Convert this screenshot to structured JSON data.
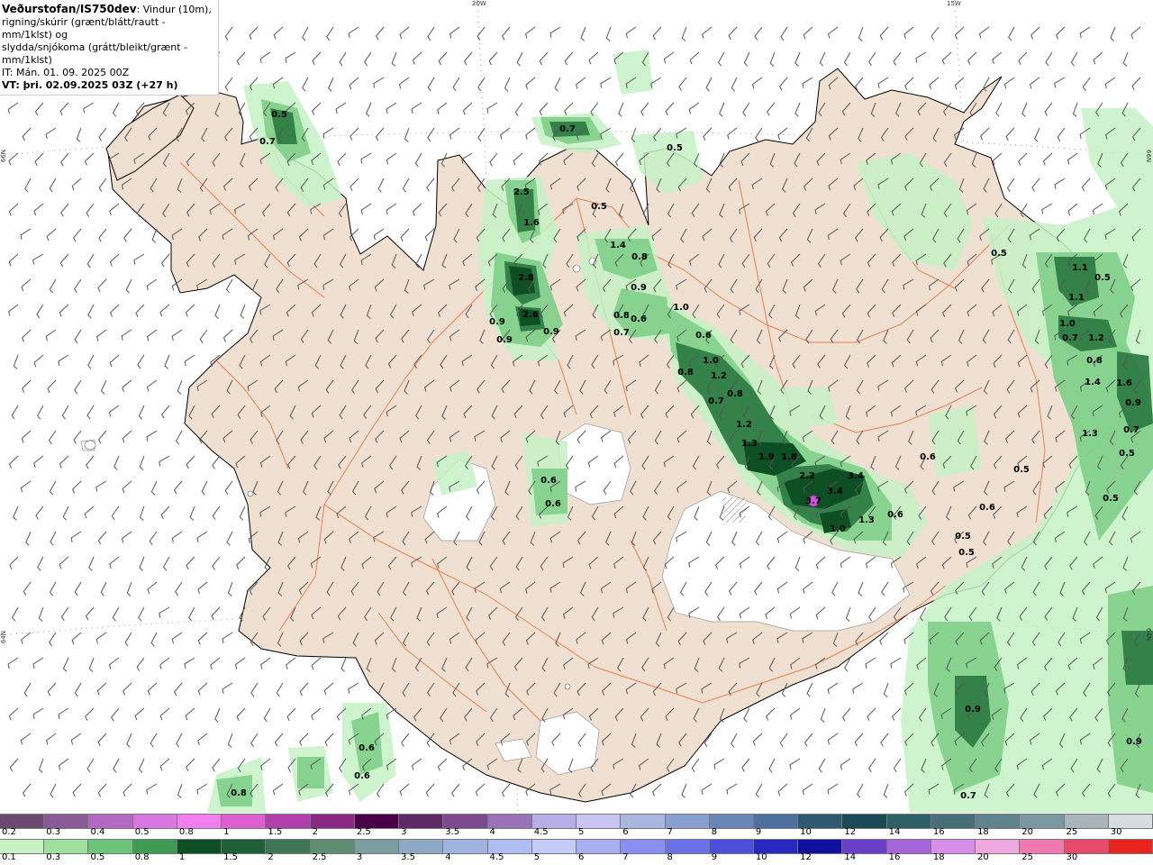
{
  "title": {
    "brand": "Veðurstofan/IS750dev",
    "desc1": ": Vindur (10m),",
    "desc2": "rigning/skúrir (grænt/blátt/rautt - mm/1klst) og",
    "desc3": "slydda/snjókoma (grátt/bleikt/grænt - mm/1klst)",
    "init": "IT: Mán. 01. 09. 2025 00Z",
    "valid": "VT: þri. 02.09.2025 03Z (+27 h)"
  },
  "coords": {
    "lon_20w": "20W",
    "lon_15w": "15W",
    "lat_66n_left": "66N",
    "lat_66n_right": "66N",
    "lat_64n_left": "64N",
    "lat_64n_right": "64N"
  },
  "colors": {
    "land": "#f0e0d2",
    "ice": "#ffffff",
    "roads": "#e4804f",
    "coast": "#000000",
    "rain_light": "#c6f2c6",
    "rain_mid": "#7fcf88",
    "rain_heavy": "#2f7d46",
    "rain_very_heavy": "#0d4f23",
    "snow_peak": "#cc55dd"
  },
  "precip_labels": [
    {
      "v": "0.5",
      "id": "nw1"
    },
    {
      "v": "0.7",
      "id": "nw2"
    },
    {
      "v": "0.7",
      "id": "n1"
    },
    {
      "v": "0.5",
      "id": "n2"
    },
    {
      "v": "0.5",
      "id": "n3"
    },
    {
      "v": "2.5",
      "id": "n4"
    },
    {
      "v": "1.6",
      "id": "n5"
    },
    {
      "v": "1.4",
      "id": "n6"
    },
    {
      "v": "0.8",
      "id": "n7"
    },
    {
      "v": "2.8",
      "id": "n8"
    },
    {
      "v": "0.9",
      "id": "n9"
    },
    {
      "v": "2.6",
      "id": "n10"
    },
    {
      "v": "0.9",
      "id": "n11"
    },
    {
      "v": "0.9",
      "id": "n12"
    },
    {
      "v": "0.8",
      "id": "n13"
    },
    {
      "v": "0.6",
      "id": "n14"
    },
    {
      "v": "0.7",
      "id": "n15"
    },
    {
      "v": "0.9",
      "id": "n16"
    },
    {
      "v": "1.0",
      "id": "c1"
    },
    {
      "v": "0.6",
      "id": "c2"
    },
    {
      "v": "1.0",
      "id": "c3"
    },
    {
      "v": "0.8",
      "id": "c4"
    },
    {
      "v": "1.2",
      "id": "c5"
    },
    {
      "v": "0.8",
      "id": "c6"
    },
    {
      "v": "0.7",
      "id": "c7"
    },
    {
      "v": "1.2",
      "id": "c8"
    },
    {
      "v": "1.3",
      "id": "c9"
    },
    {
      "v": "1.9",
      "id": "c10"
    },
    {
      "v": "1.8",
      "id": "c11"
    },
    {
      "v": "2.2",
      "id": "c12"
    },
    {
      "v": "3.4",
      "id": "c13"
    },
    {
      "v": "3.4",
      "id": "c14"
    },
    {
      "v": "3.7",
      "id": "c15"
    },
    {
      "v": "1.0",
      "id": "c16"
    },
    {
      "v": "1.3",
      "id": "c17"
    },
    {
      "v": "0.6",
      "id": "c18"
    },
    {
      "v": "0.6",
      "id": "c19"
    },
    {
      "v": "0.6",
      "id": "c20"
    },
    {
      "v": "0.6",
      "id": "c21"
    },
    {
      "v": "0.5",
      "id": "e1"
    },
    {
      "v": "1.1",
      "id": "e2"
    },
    {
      "v": "0.5",
      "id": "e3"
    },
    {
      "v": "1.1",
      "id": "e4"
    },
    {
      "v": "1.0",
      "id": "e5"
    },
    {
      "v": "0.7",
      "id": "e6"
    },
    {
      "v": "1.2",
      "id": "e7"
    },
    {
      "v": "0.8",
      "id": "e8"
    },
    {
      "v": "1.4",
      "id": "e9"
    },
    {
      "v": "1.6",
      "id": "e10"
    },
    {
      "v": "0.9",
      "id": "e11"
    },
    {
      "v": "0.7",
      "id": "e12"
    },
    {
      "v": "1.3",
      "id": "e13"
    },
    {
      "v": "0.5",
      "id": "e14"
    },
    {
      "v": "0.5",
      "id": "e15"
    },
    {
      "v": "0.5",
      "id": "e16"
    },
    {
      "v": "0.6",
      "id": "e17"
    },
    {
      "v": "0.5",
      "id": "e18"
    },
    {
      "v": "0.5",
      "id": "e19"
    },
    {
      "v": "0.9",
      "id": "s1"
    },
    {
      "v": "0.9",
      "id": "s2"
    },
    {
      "v": "0.7",
      "id": "s3"
    },
    {
      "v": "0.6",
      "id": "s4"
    },
    {
      "v": "0.6",
      "id": "s5"
    },
    {
      "v": "0.8",
      "id": "s6"
    }
  ],
  "legend_top": {
    "labels": [
      "0.2",
      "0.3",
      "0.4",
      "0.5",
      "0.8",
      "1",
      "1.5",
      "2",
      "2.5",
      "3",
      "3.5",
      "4",
      "4.5",
      "5",
      "6",
      "7",
      "8",
      "9",
      "10",
      "12",
      "14",
      "16",
      "18",
      "20",
      "25",
      "30"
    ],
    "colors": [
      "#6b4a70",
      "#8a5a96",
      "#b368c4",
      "#d877e2",
      "#f47ef0",
      "#dd5fd0",
      "#b33fae",
      "#8a2886",
      "#4a0047",
      "#5e2a66",
      "#7d4a90",
      "#9a72b8",
      "#b7b0e8",
      "#c8c5f2",
      "#a9b6e0",
      "#8a9fd0",
      "#6a86b8",
      "#4f6f9f",
      "#2f5970",
      "#1a4a55",
      "#2d5f66",
      "#466f78",
      "#5f848c",
      "#7b979f",
      "#a8b6bb",
      "#d6dcdf"
    ]
  },
  "legend_bottom": {
    "labels": [
      "0.1",
      "0.3",
      "0.5",
      "0.8",
      "1",
      "1.5",
      "2",
      "2.5",
      "3",
      "3.5",
      "4",
      "4.5",
      "5",
      "6",
      "7",
      "8",
      "9",
      "10",
      "12",
      "14",
      "16",
      "18",
      "20",
      "25",
      "30"
    ],
    "colors": [
      "#c6f2c6",
      "#9fe09f",
      "#6cc47a",
      "#3e9a55",
      "#0d4f23",
      "#1e5f38",
      "#3c7656",
      "#5f8d74",
      "#7a9ea0",
      "#8fa9c4",
      "#9fb3e0",
      "#aebdf2",
      "#c3cbf6",
      "#a9aef0",
      "#8a8ef0",
      "#6a70e6",
      "#4a4ed8",
      "#2828c0",
      "#0f0fa0",
      "#6a3fc8",
      "#a566dc",
      "#d88ee8",
      "#f0a8e0",
      "#f07ab0",
      "#e84a6a",
      "#e8241c"
    ]
  }
}
